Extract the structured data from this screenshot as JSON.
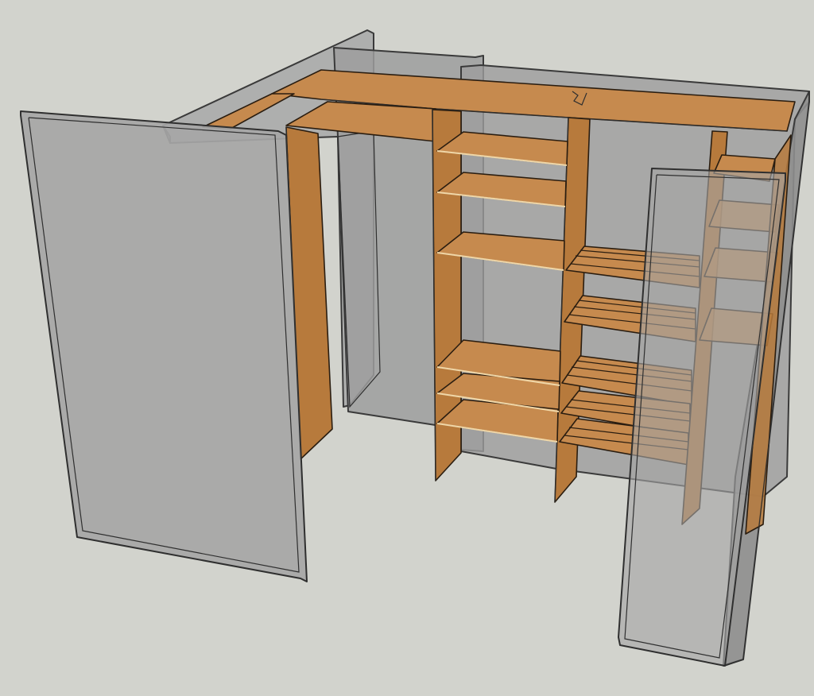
{
  "scene": {
    "background": "#d2d3cd",
    "colors": {
      "wood_top": "#c68a4e",
      "wood_side": "#b77a3c",
      "wood_edge": "#f0d7a8",
      "wall_gray": "#9c9c9c",
      "wall_dark": "#8c8c8c",
      "glass": "#a7a7a7",
      "outline": "#2f2f2f"
    },
    "elements": [
      "back-wall-left",
      "back-wall-right",
      "left-side-panel",
      "right-front-panel",
      "top-shelf",
      "shelf-units",
      "slatted-shelves"
    ]
  }
}
